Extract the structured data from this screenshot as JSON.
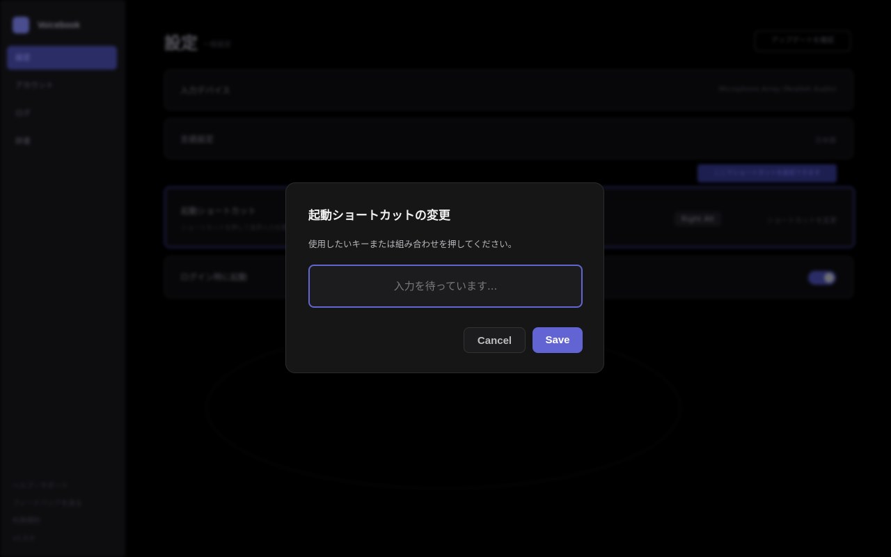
{
  "background": {
    "brand": {
      "name": "Voicebook"
    },
    "sidebar": {
      "items": [
        {
          "label": "設定",
          "active": true
        },
        {
          "label": "アカウント"
        },
        {
          "label": "ログ"
        },
        {
          "label": "辞書"
        }
      ],
      "footer": [
        "ヘルプ・サポート",
        "フィードバックを送る",
        "利用規約",
        "v1.0.0"
      ]
    },
    "header": {
      "title": "設定",
      "subtitle": "一般設定",
      "update_button": "アップデートを確認"
    },
    "rows": {
      "input_device": {
        "label": "入力デバイス",
        "value": "Microphone Array (Realtek Audio)"
      },
      "language": {
        "label": "言語設定",
        "value": "日本語"
      },
      "hint": "ここでショートカットを設定できます",
      "shortcut": {
        "label": "起動ショートカット",
        "sub": "ショートカットを押して音声入力を開始します",
        "key": "Right Alt",
        "action": "ショートカットを変更"
      },
      "startup": {
        "label": "ログイン時に起動",
        "enabled": true
      }
    }
  },
  "dialog": {
    "title": "起動ショートカットの変更",
    "description": "使用したいキーまたは組み合わせを押してください。",
    "input_placeholder": "入力を待っています...",
    "input_value": "",
    "cancel_label": "Cancel",
    "save_label": "Save"
  },
  "colors": {
    "accent": "#6264d4",
    "dialog_bg": "#161617",
    "overlay": "#000000"
  }
}
